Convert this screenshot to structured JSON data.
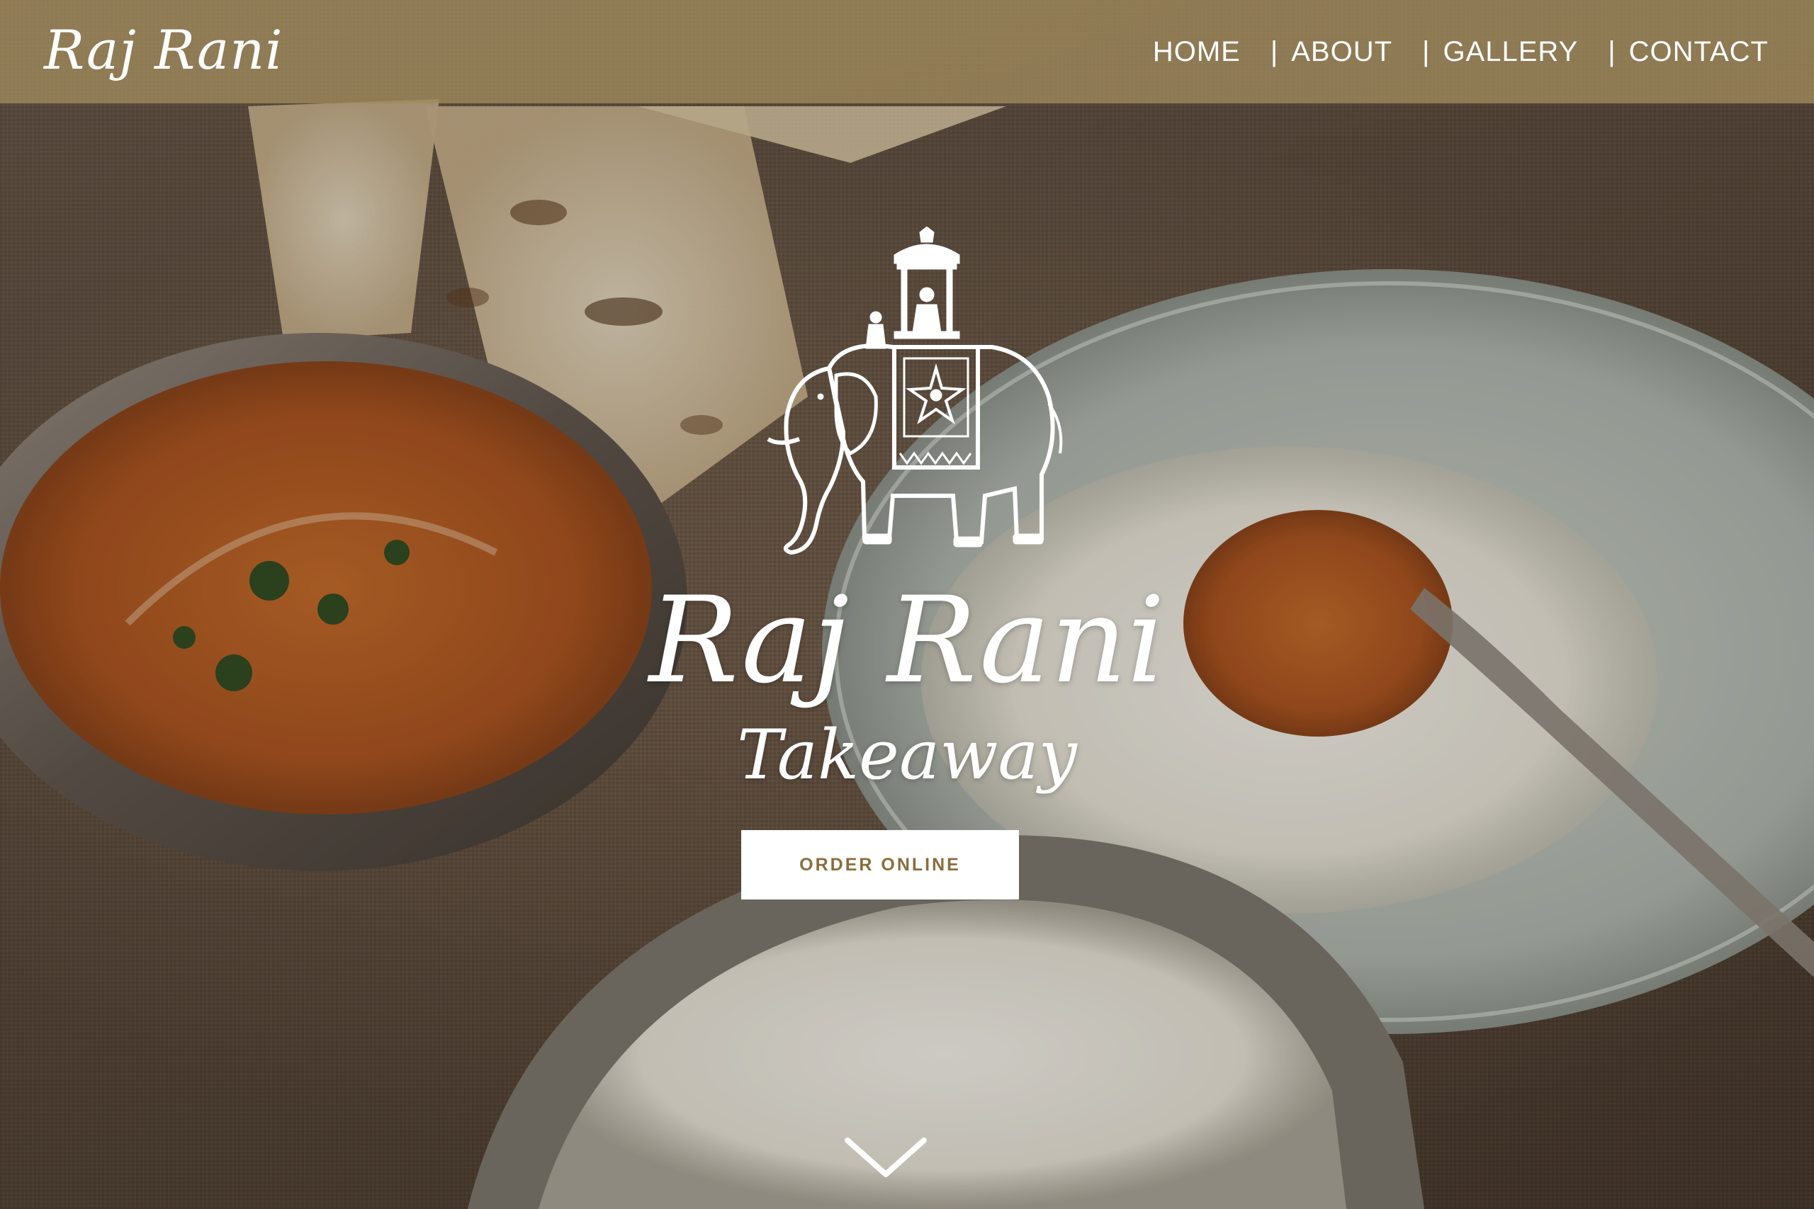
{
  "navbar": {
    "brand": "Raj Rani",
    "links": [
      {
        "label": "HOME"
      },
      {
        "label": "ABOUT"
      },
      {
        "label": "GALLERY"
      },
      {
        "label": "CONTACT"
      }
    ],
    "separator": "|",
    "background_color": "#a08a5c"
  },
  "hero": {
    "logo_icon": "elephant-with-howdah-icon",
    "title": "Raj Rani",
    "subtitle": "Takeaway",
    "order_button_label": "ORDER ONLINE",
    "order_button_text_color": "#8a6d3b",
    "scroll_icon": "chevron-down-icon"
  }
}
